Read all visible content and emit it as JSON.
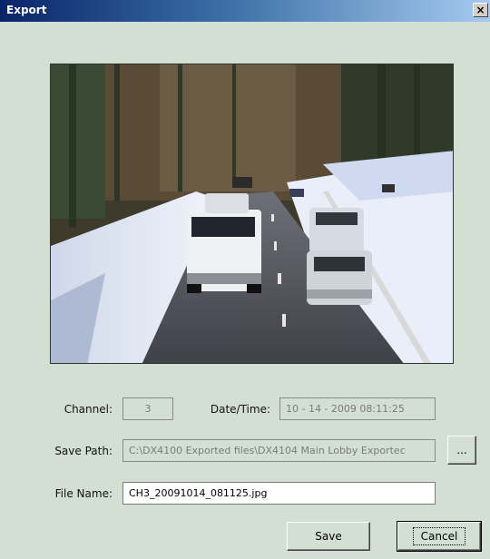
{
  "window": {
    "title": "Export",
    "close_glyph": "×"
  },
  "form": {
    "channel_label": "Channel:",
    "channel_value": "3",
    "datetime_label": "Date/Time:",
    "datetime_value": "10 - 14 - 2009  08:11:25",
    "save_path_label": "Save Path:",
    "save_path_value": "C:\\DX4100 Exported files\\DX4104 Main Lobby Exportec",
    "browse_label": "...",
    "file_name_label": "File Name:",
    "file_name_value": "CH3_20091014_081125.jpg"
  },
  "buttons": {
    "save": "Save",
    "cancel": "Cancel"
  },
  "colors": {
    "dialog_bg": "#d4dfd3",
    "title_bar": "#0a246a"
  }
}
